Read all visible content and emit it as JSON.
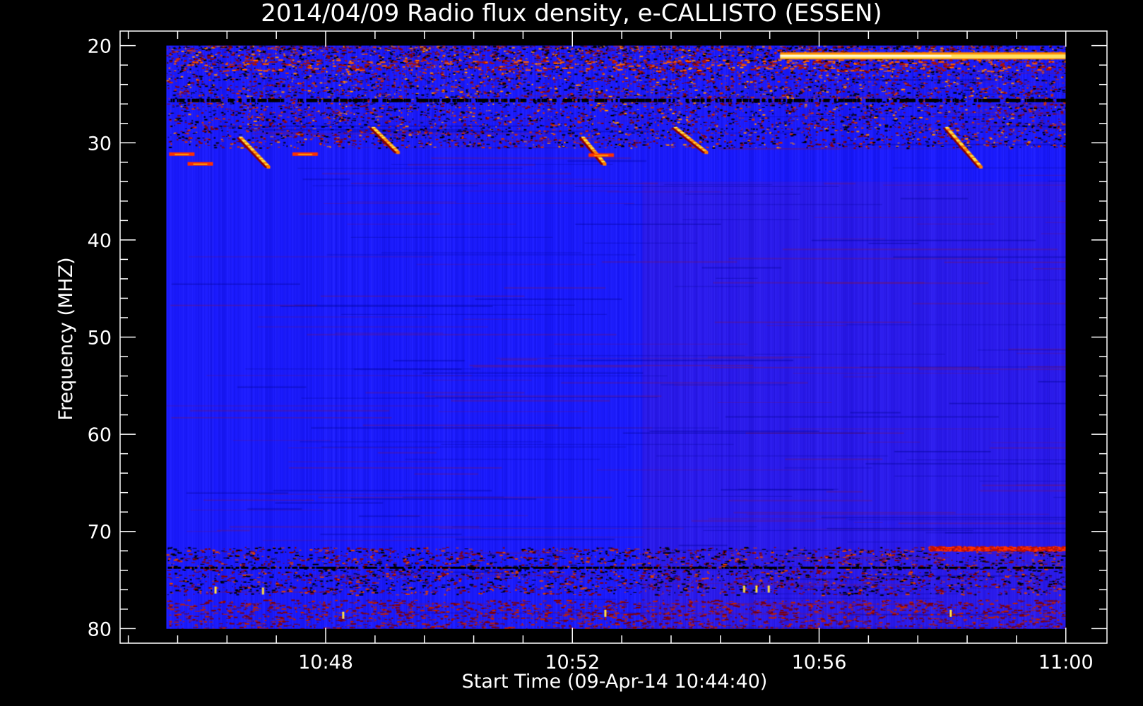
{
  "chart_data": {
    "type": "heatmap",
    "title": "2014/04/09  Radio flux density, e-CALLISTO (ESSEN)",
    "xlabel": "Start Time (09-Apr-14 10:44:40)",
    "ylabel": "Frequency (MHZ)",
    "x_range_minutes": [
      0,
      16
    ],
    "x_tick_minutes": [
      3.333,
      7.333,
      11.333,
      15.333
    ],
    "x_tick_labels": [
      "10:48",
      "10:52",
      "10:56",
      "11:00"
    ],
    "x_minor_step_minutes": 0.8,
    "y_range_mhz": [
      18.5,
      81.5
    ],
    "y_data_mhz": [
      20,
      80
    ],
    "y_ticks_mhz": [
      20,
      30,
      40,
      50,
      60,
      70,
      80
    ],
    "y_minor_step_mhz": 2,
    "data_x_range_minutes": [
      0.75,
      15.33
    ],
    "colorscale": [
      "#000000",
      "#7a0000",
      "#d42a00",
      "#ff7800",
      "#ffd84a",
      "#ffffff"
    ],
    "background_color": "#1a1aff",
    "features": [
      {
        "name": "type-III-burst",
        "t_start": 1.95,
        "t_end": 2.4,
        "f_start": 29.5,
        "f_end": 32.5
      },
      {
        "name": "type-III-burst",
        "t_start": 4.1,
        "t_end": 4.5,
        "f_start": 28.5,
        "f_end": 31
      },
      {
        "name": "type-III-burst",
        "t_start": 7.5,
        "t_end": 7.85,
        "f_start": 29.5,
        "f_end": 32.2
      },
      {
        "name": "type-III-burst",
        "t_start": 9.0,
        "t_end": 9.5,
        "f_start": 28.5,
        "f_end": 31
      },
      {
        "name": "type-III-burst",
        "t_start": 13.4,
        "t_end": 13.95,
        "f_start": 28.5,
        "f_end": 32.5
      },
      {
        "name": "narrowband-interference",
        "t_start": 10.7,
        "t_end": 15.33,
        "f_start": 20.9,
        "f_end": 21.3
      },
      {
        "name": "interference-band",
        "t_start": 0.75,
        "t_end": 15.33,
        "f_start": 71.6,
        "f_end": 74.2
      }
    ]
  }
}
